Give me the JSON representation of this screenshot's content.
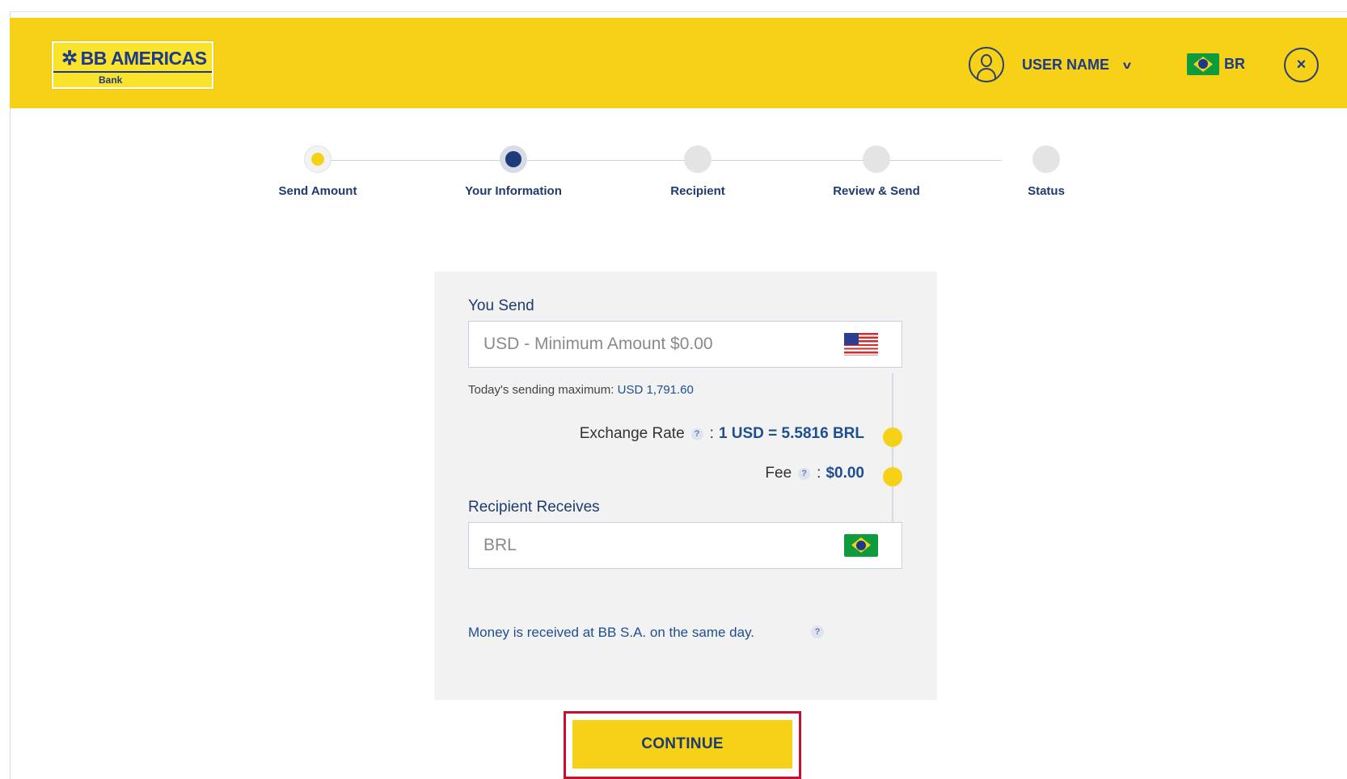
{
  "header": {
    "logo_text": "BB Americas",
    "logo_sub": "Bank",
    "user_name": "USER NAME",
    "language": "BR",
    "close_label": "×"
  },
  "steps": [
    {
      "label": "Send Amount",
      "state": "done"
    },
    {
      "label": "Your Information",
      "state": "active"
    },
    {
      "label": "Recipient",
      "state": "todo"
    },
    {
      "label": "Review & Send",
      "state": "todo"
    },
    {
      "label": "Status",
      "state": "todo"
    }
  ],
  "form": {
    "send_label": "You Send",
    "send_placeholder": "USD - Minimum Amount $0.00",
    "max_prefix": "Today's sending maximum:",
    "max_value": "USD 1,791.60",
    "rate_label": "Exchange Rate",
    "rate_value": "1 USD = 5.5816 BRL",
    "fee_label": "Fee",
    "fee_value": "$0.00",
    "receive_label": "Recipient Receives",
    "receive_placeholder": "BRL",
    "note": "Money is received at BB S.A. on the same day.",
    "help_glyph": "?",
    "colon": ":"
  },
  "actions": {
    "continue_label": "CONTINUE"
  },
  "colors": {
    "brand_yellow": "#f7d117",
    "brand_blue": "#1c3a8c",
    "highlight_red": "#c8102e"
  },
  "icons": {
    "user": "user-avatar-icon",
    "chevron": "chevron-down-icon",
    "close": "close-icon",
    "flag_us": "us-flag-icon",
    "flag_br": "brazil-flag-icon",
    "help": "help-icon"
  }
}
